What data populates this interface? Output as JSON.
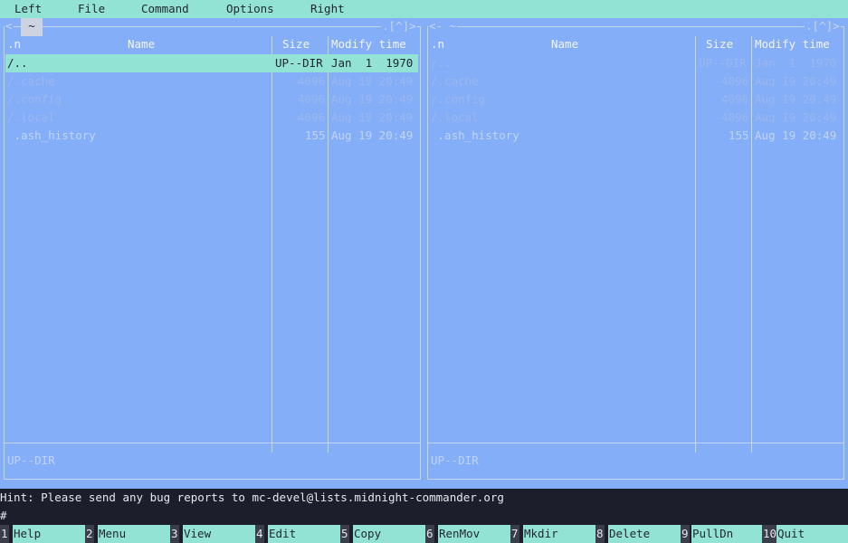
{
  "menubar": {
    "items": [
      "Left",
      "File",
      "Command",
      "Options",
      "Right"
    ]
  },
  "left_panel": {
    "path": "~",
    "corner_right": ".[^]>",
    "corner_left": "<",
    "columns": {
      "sort": ".n",
      "name": "Name",
      "size": "Size",
      "mtime": "Modify time"
    },
    "rows": [
      {
        "name": "/..",
        "size": "UP--DIR",
        "mtime": "Jan  1  1970",
        "selected": true
      },
      {
        "name": "/.cache",
        "size": "4096",
        "mtime": "Aug 19 20:49",
        "selected": false
      },
      {
        "name": "/.config",
        "size": "4096",
        "mtime": "Aug 19 20:49",
        "selected": false
      },
      {
        "name": "/.local",
        "size": "4096",
        "mtime": "Aug 19 20:49",
        "selected": false
      },
      {
        "name": " .ash_history",
        "size": "155",
        "mtime": "Aug 19 20:49",
        "selected": false
      }
    ],
    "status": "UP--DIR"
  },
  "right_panel": {
    "corner_left": "<- ~",
    "corner_right": ".[^]>",
    "columns": {
      "sort": ".n",
      "name": "Name",
      "size": "Size",
      "mtime": "Modify time"
    },
    "rows": [
      {
        "name": "/..",
        "size": "UP--DIR",
        "mtime": "Jan  1  1970"
      },
      {
        "name": "/.cache",
        "size": "4096",
        "mtime": "Aug 19 20:49"
      },
      {
        "name": "/.config",
        "size": "4096",
        "mtime": "Aug 19 20:49"
      },
      {
        "name": "/.local",
        "size": "4096",
        "mtime": "Aug 19 20:49"
      },
      {
        "name": " .ash_history",
        "size": "155",
        "mtime": "Aug 19 20:49"
      }
    ],
    "status": "UP--DIR"
  },
  "hint": "Hint: Please send any bug reports to mc-devel@lists.midnight-commander.org",
  "prompt": "#",
  "fkeys": [
    {
      "num": "1",
      "label": "Help"
    },
    {
      "num": "2",
      "label": "Menu"
    },
    {
      "num": "3",
      "label": "View"
    },
    {
      "num": "4",
      "label": "Edit"
    },
    {
      "num": "5",
      "label": "Copy"
    },
    {
      "num": "6",
      "label": "RenMov"
    },
    {
      "num": "7",
      "label": "Mkdir"
    },
    {
      "num": "8",
      "label": "Delete"
    },
    {
      "num": "9",
      "label": "PullDn"
    },
    {
      "num": "10",
      "label": "Quit"
    }
  ],
  "colors": {
    "panel_bg": "#84aef7",
    "menubar_bg": "#92e3d3",
    "selection_bg": "#92e3d3",
    "terminal_bg": "#1c1f2b"
  }
}
